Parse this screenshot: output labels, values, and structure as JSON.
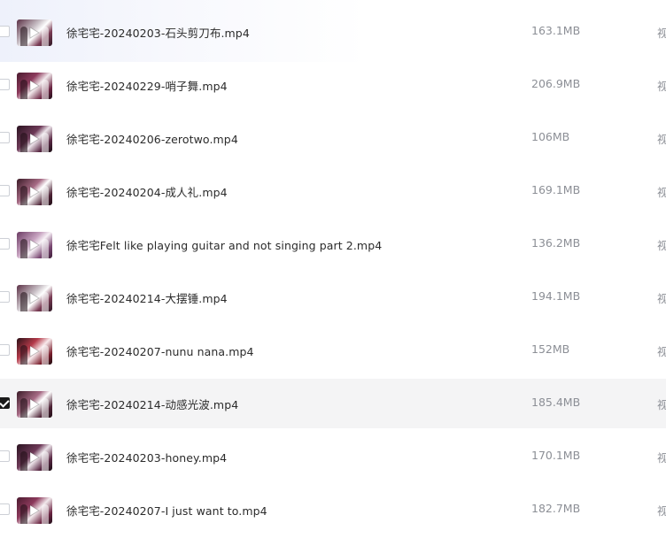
{
  "files": [
    {
      "name": "徐宅宅-20240203-石头剪刀布.mp4",
      "size": "163.1MB",
      "type": "视",
      "checked": false
    },
    {
      "name": "徐宅宅-20240229-哨子舞.mp4",
      "size": "206.9MB",
      "type": "视",
      "checked": false
    },
    {
      "name": "徐宅宅-20240206-zerotwo.mp4",
      "size": "106MB",
      "type": "视",
      "checked": false
    },
    {
      "name": "徐宅宅-20240204-成人礼.mp4",
      "size": "169.1MB",
      "type": "视",
      "checked": false
    },
    {
      "name": "徐宅宅Felt like playing guitar and not singing part 2.mp4",
      "size": "136.2MB",
      "type": "视",
      "checked": false
    },
    {
      "name": "徐宅宅-20240214-大摆锤.mp4",
      "size": "194.1MB",
      "type": "视",
      "checked": false
    },
    {
      "name": "徐宅宅-20240207-nunu nana.mp4",
      "size": "152MB",
      "type": "视",
      "checked": false
    },
    {
      "name": "徐宅宅-20240214-动感光波.mp4",
      "size": "185.4MB",
      "type": "视",
      "checked": true
    },
    {
      "name": "徐宅宅-20240203-honey.mp4",
      "size": "170.1MB",
      "type": "视",
      "checked": false
    },
    {
      "name": "徐宅宅-20240207-I just want to.mp4",
      "size": "182.7MB",
      "type": "视",
      "checked": false
    }
  ],
  "colors": {
    "selected_row_bg": "#f4f4f5",
    "checkbox_checked": "#1a1a1a",
    "size_text": "#8c8f96"
  },
  "icons": {
    "thumbnail_overlay": "play-icon"
  }
}
